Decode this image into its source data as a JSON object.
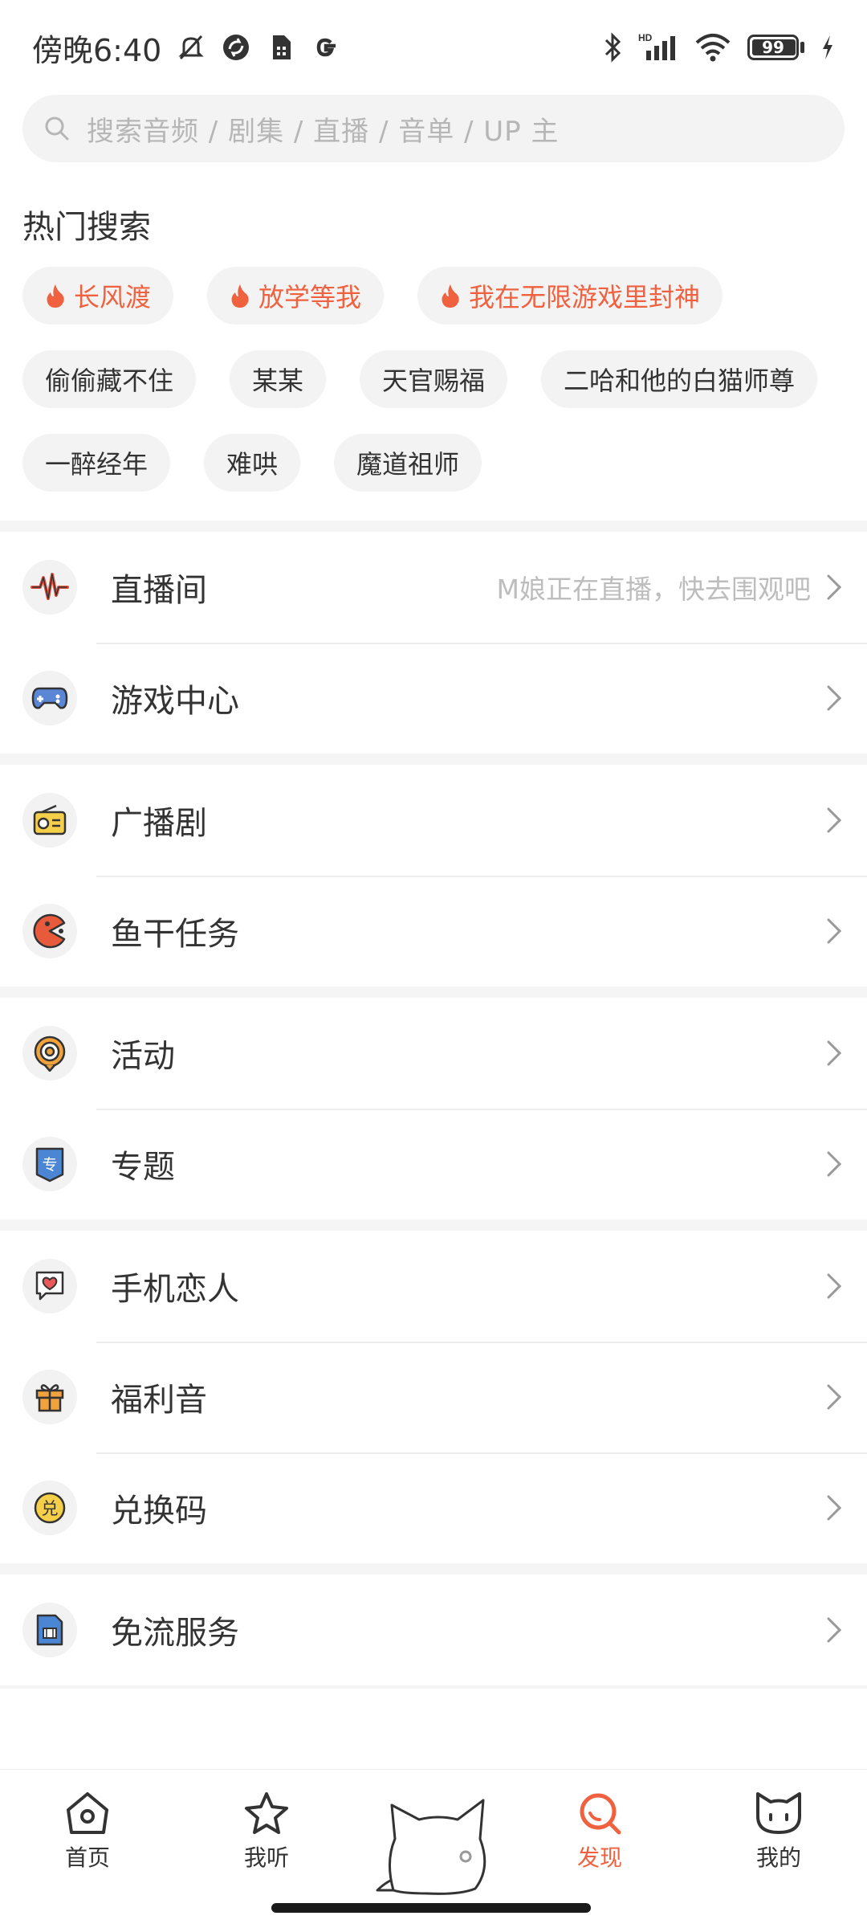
{
  "status_bar": {
    "time": "傍晚6:40",
    "battery_level": "99"
  },
  "search": {
    "placeholder": "搜索音频 / 剧集 / 直播 / 音单 / UP 主"
  },
  "hot_search": {
    "title": "热门搜索",
    "hot_tags": [
      "长风渡",
      "放学等我",
      "我在无限游戏里封神"
    ],
    "tags_row2": [
      "偷偷藏不住",
      "某某",
      "天官赐福",
      "二哈和他的白猫师尊"
    ],
    "tags_row3": [
      "一醉经年",
      "难哄",
      "魔道祖师"
    ]
  },
  "menu": {
    "live": {
      "label": "直播间",
      "subtitle": "M娘正在直播，快去围观吧",
      "icon": "live-wave-icon"
    },
    "game": {
      "label": "游戏中心",
      "icon": "gamepad-icon"
    },
    "drama": {
      "label": "广播剧",
      "icon": "radio-icon"
    },
    "task": {
      "label": "鱼干任务",
      "icon": "pacman-icon"
    },
    "event": {
      "label": "活动",
      "icon": "target-icon"
    },
    "topic": {
      "label": "专题",
      "icon": "topic-badge-icon",
      "badge": "专"
    },
    "lover": {
      "label": "手机恋人",
      "icon": "heart-chat-icon"
    },
    "welfare": {
      "label": "福利音",
      "icon": "gift-icon"
    },
    "redeem": {
      "label": "兑换码",
      "icon": "redeem-coin-icon",
      "badge": "兑"
    },
    "free": {
      "label": "免流服务",
      "icon": "sim-card-icon"
    }
  },
  "bottom_nav": {
    "home": "首页",
    "listen": "我听",
    "discover": "发现",
    "mine": "我的"
  },
  "colors": {
    "accent": "#f0623f",
    "gray_bg": "#f3f3f3"
  }
}
